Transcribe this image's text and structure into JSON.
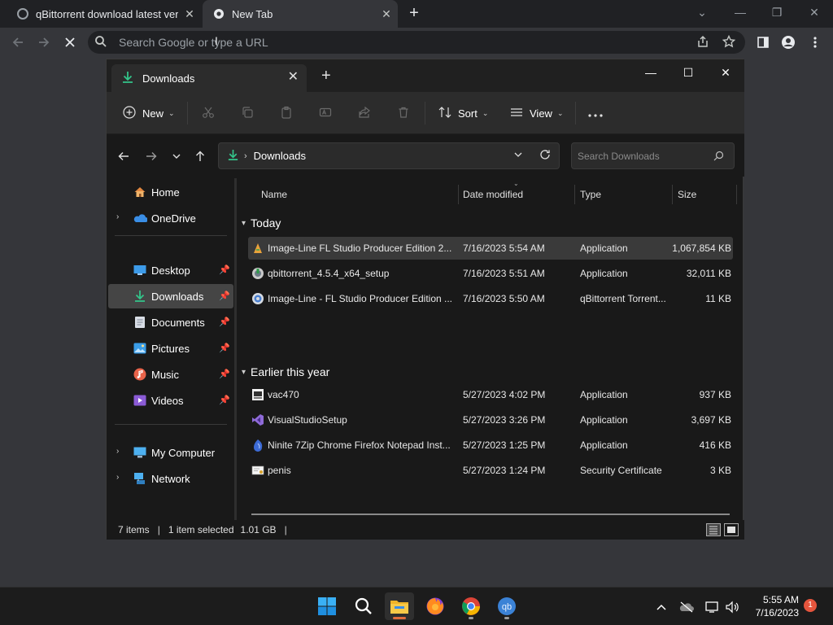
{
  "browser": {
    "tabs": [
      {
        "title": "qBittorrent download latest versi",
        "active": false
      },
      {
        "title": "New Tab",
        "active": true
      }
    ],
    "omnibox": {
      "placeholder": "Search Google or type a URL"
    }
  },
  "explorer": {
    "tab_title": "Downloads",
    "commands": {
      "new": "New",
      "sort": "Sort",
      "view": "View"
    },
    "breadcrumb": "Downloads",
    "search_placeholder": "Search Downloads",
    "sidebar": {
      "home": "Home",
      "onedrive": "OneDrive",
      "desktop": "Desktop",
      "downloads": "Downloads",
      "documents": "Documents",
      "pictures": "Pictures",
      "music": "Music",
      "videos": "Videos",
      "my_computer": "My Computer",
      "network": "Network"
    },
    "columns": {
      "name": "Name",
      "date": "Date modified",
      "type": "Type",
      "size": "Size"
    },
    "groups": {
      "today": "Today",
      "earlier": "Earlier this year"
    },
    "files": [
      {
        "name": "Image-Line FL Studio Producer Edition 2...",
        "date": "7/16/2023 5:54 AM",
        "type": "Application",
        "size": "1,067,854 KB"
      },
      {
        "name": "qbittorrent_4.5.4_x64_setup",
        "date": "7/16/2023 5:51 AM",
        "type": "Application",
        "size": "32,011 KB"
      },
      {
        "name": "Image-Line - FL Studio Producer Edition ...",
        "date": "7/16/2023 5:50 AM",
        "type": "qBittorrent Torrent...",
        "size": "11 KB"
      },
      {
        "name": "vac470",
        "date": "5/27/2023 4:02 PM",
        "type": "Application",
        "size": "937 KB"
      },
      {
        "name": "VisualStudioSetup",
        "date": "5/27/2023 3:26 PM",
        "type": "Application",
        "size": "3,697 KB"
      },
      {
        "name": "Ninite 7Zip Chrome Firefox Notepad Inst...",
        "date": "5/27/2023 1:25 PM",
        "type": "Application",
        "size": "416 KB"
      },
      {
        "name": "penis",
        "date": "5/27/2023 1:24 PM",
        "type": "Security Certificate",
        "size": "3 KB"
      }
    ],
    "status": {
      "items": "7 items",
      "selected": "1 item selected",
      "selected_size": "1.01 GB"
    }
  },
  "taskbar": {
    "time": "5:55 AM",
    "date": "7/16/2023",
    "notification_count": "1"
  }
}
